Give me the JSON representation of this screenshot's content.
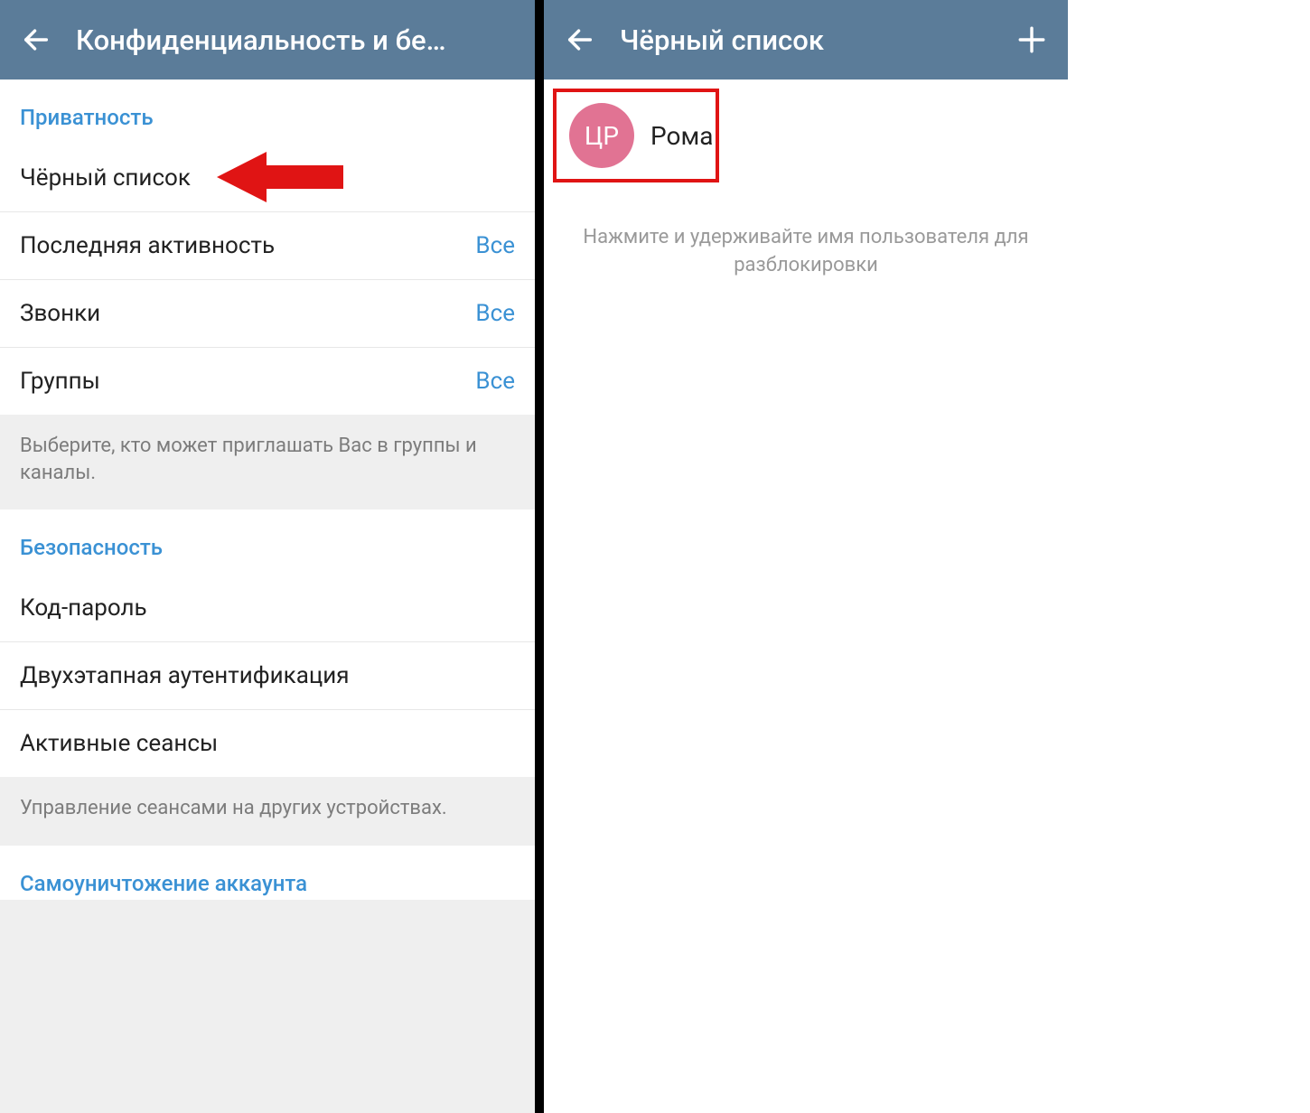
{
  "left": {
    "header_title": "Конфиденциальность и бе…",
    "privacy_header": "Приватность",
    "rows": {
      "blacklist": {
        "label": "Чёрный список"
      },
      "lastseen": {
        "label": "Последняя активность",
        "value": "Все"
      },
      "calls": {
        "label": "Звонки",
        "value": "Все"
      },
      "groups": {
        "label": "Группы",
        "value": "Все"
      }
    },
    "groups_info": "Выберите, кто может приглашать Вас в группы и каналы.",
    "security_header": "Безопасность",
    "security_rows": {
      "passcode": {
        "label": "Код-пароль"
      },
      "twostep": {
        "label": "Двухэтапная аутентификация"
      },
      "sessions": {
        "label": "Активные сеансы"
      }
    },
    "sessions_info": "Управление сеансами на других устройствах.",
    "selfdestruct_header": "Самоуничтожение аккаунта"
  },
  "right": {
    "header_title": "Чёрный список",
    "user": {
      "initials": "ЦР",
      "name": "Рома"
    },
    "hint": "Нажмите и удерживайте имя пользователя для разблокировки"
  }
}
